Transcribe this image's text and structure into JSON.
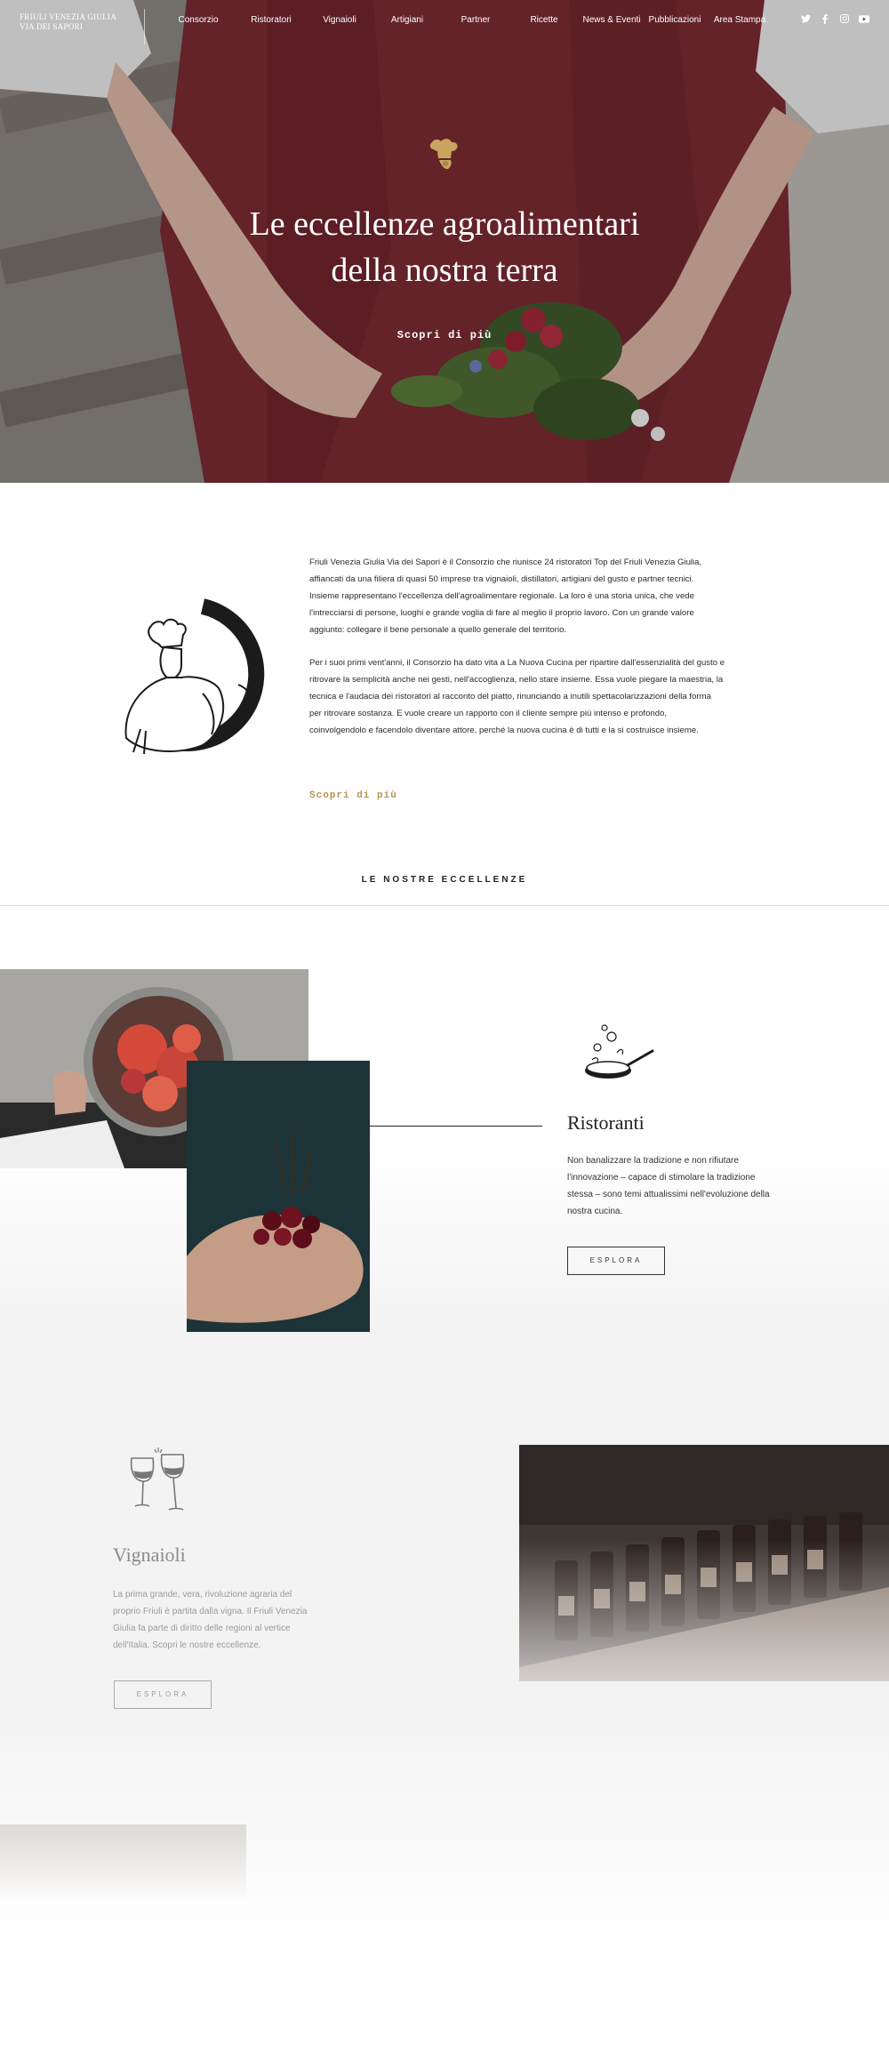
{
  "header": {
    "brand_line1": "FRIULI VENEZIA GIULIA",
    "brand_line2": "VIA DEI SAPORI",
    "nav": [
      {
        "label": "Consorzio"
      },
      {
        "label": "Ristoratori"
      },
      {
        "label": "Vignaioli"
      },
      {
        "label": "Artigiani"
      },
      {
        "label": "Partner"
      },
      {
        "label": "Ricette"
      },
      {
        "label": "News & Eventi"
      },
      {
        "label": "Pubblicazioni"
      },
      {
        "label": "Area Stampa"
      }
    ],
    "social": [
      "twitter-icon",
      "facebook-icon",
      "instagram-icon",
      "youtube-icon"
    ]
  },
  "hero": {
    "title_line1": "Le eccellenze agroalimentari",
    "title_line2": "della nostra terra",
    "cta": "Scopri di più"
  },
  "intro": {
    "paragraph1": "Friuli Venezia Giulia Via dei Sapori è il Consorzio che riunisce 24 ristoratori Top del Friuli Venezia Giulia, affiancati da una filiera di quasi 50 imprese tra vignaioli, distillatori, artigiani del gusto e partner tecnici. Insieme rappresentano l'eccellenza dell'agroalimentare regionale. La loro è una storia unica, che vede l'intrecciarsi di persone, luoghi e grande voglia di fare al meglio il proprio lavoro. Con un grande valore aggiunto: collegare il bene personale a quello generale del territorio.",
    "paragraph2": "Per i suoi primi vent'anni, il Consorzio ha dato vita a La Nuova Cucina per ripartire dall'essenzialità del gusto e ritrovare la semplicità anche nei gesti, nell'accoglienza, nello stare insieme. Essa vuole piegare la maestria, la tecnica e l'audacia dei ristoratori al racconto del piatto, rinunciando a inutili spettacolarizzazioni della forma per ritrovare sostanza. E vuole creare un rapporto con il cliente sempre più intenso e profondo, coinvolgendolo e facendolo diventare attore, perché la nuova cucina è di tutti e la si costruisce insieme.",
    "cta": "Scopri di più"
  },
  "section": {
    "title": "LE NOSTRE ECCELLENZE"
  },
  "ristoranti": {
    "title": "Ristoranti",
    "description": "Non banalizzare la tradizione e non rifiutare l'innovazione – capace di stimolare la tradizione stessa – sono temi attualissimi nell'evoluzione della nostra cucina.",
    "button": "ESPLORA"
  },
  "vignaioli": {
    "title": "Vignaioli",
    "description": "La prima grande, vera, rivoluzione agraria del proprio Friuli è partita dalla vigna. Il Friuli Venezia Giulia fa parte di diritto delle regioni al vertice dell'Italia. Scopri le nostre eccellenze.",
    "button": "ESPLORA"
  },
  "colors": {
    "accent_gold": "#b59454",
    "text_dark": "#222222",
    "muted": "#9a9a9a"
  }
}
